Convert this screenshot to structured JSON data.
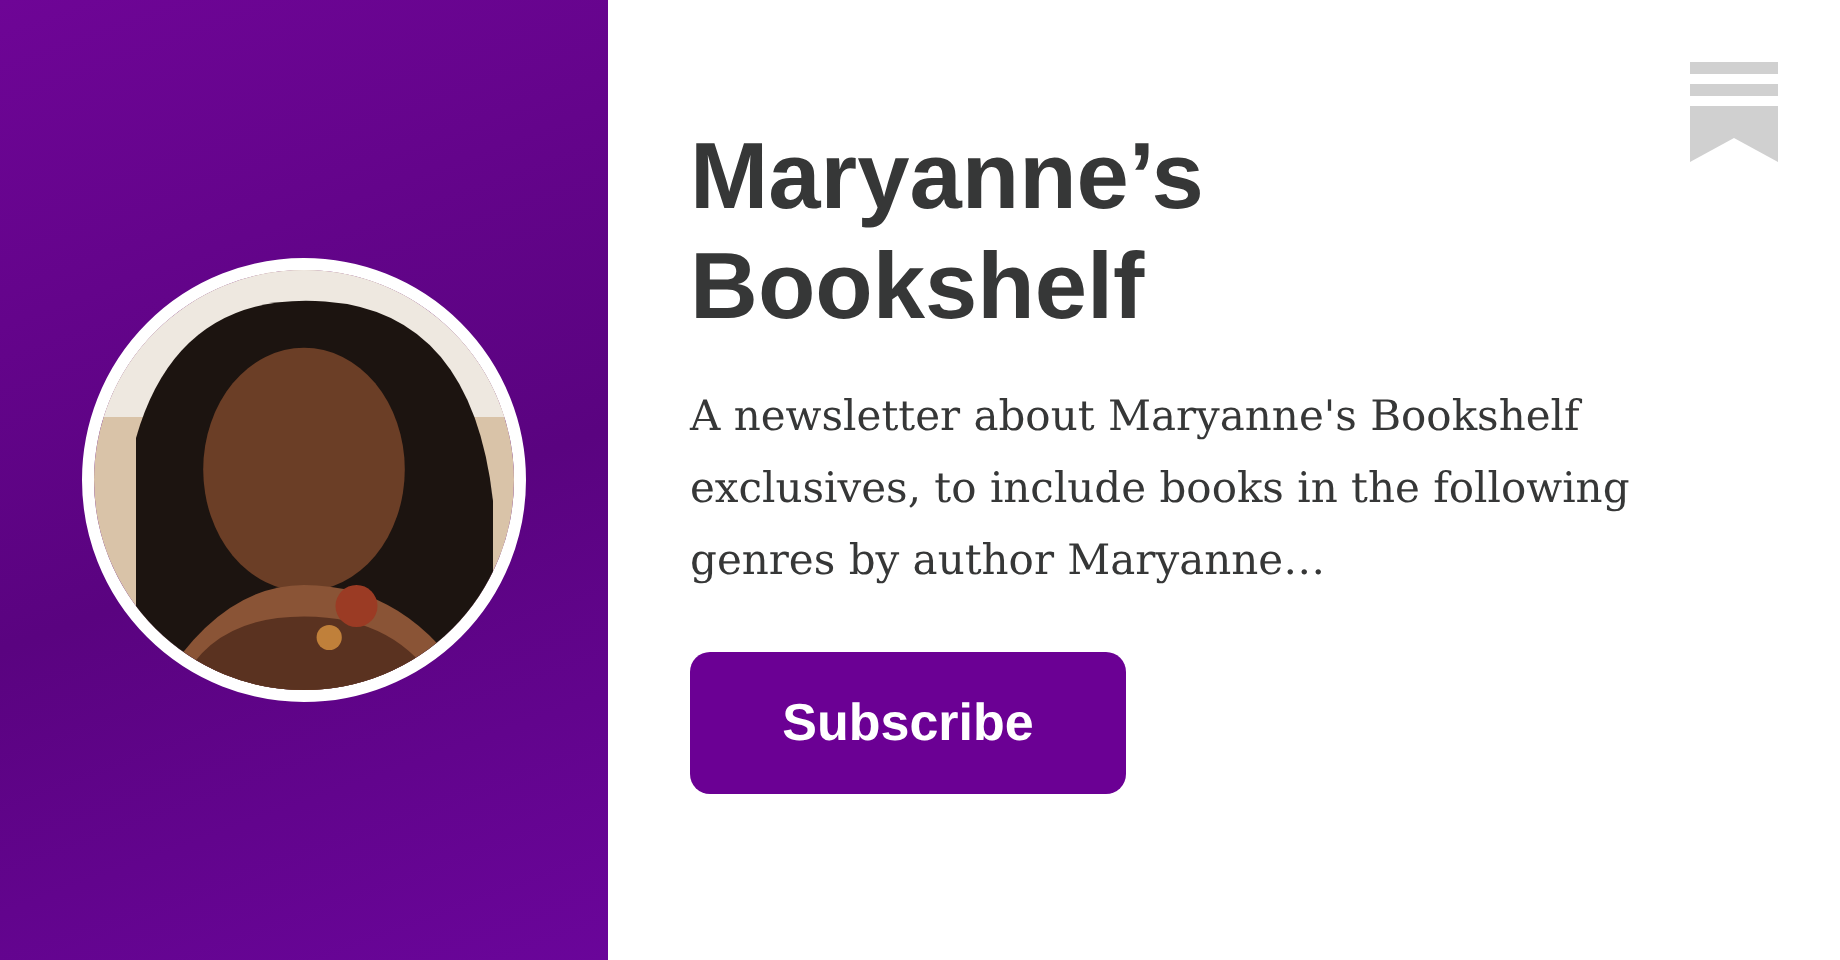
{
  "title": "Maryanne’s Bookshelf",
  "description": "A newsletter about Maryanne's Bookshelf exclusives, to include books in the following genres by author Maryanne…",
  "subscribe_button": {
    "label": "Subscribe"
  }
}
